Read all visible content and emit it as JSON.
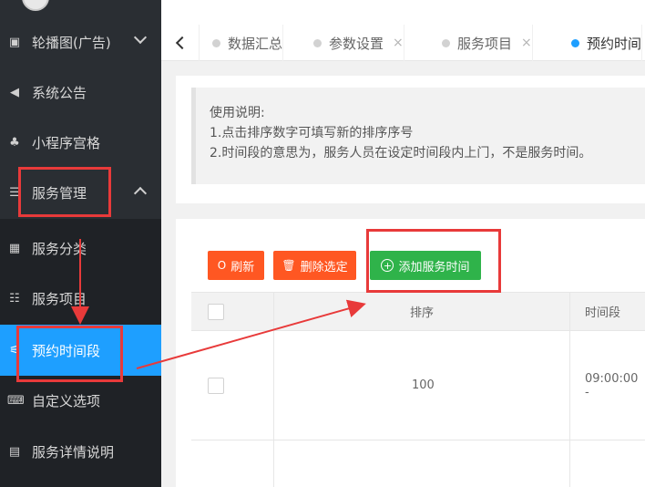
{
  "sidebar": {
    "user": {
      "name": ""
    },
    "items": [
      {
        "label": "轮播图(广告)",
        "icon": "image-icon",
        "glyph": "▣",
        "expand": "down"
      },
      {
        "label": "系统公告",
        "icon": "speaker-icon",
        "glyph": "◀",
        "expand": ""
      },
      {
        "label": "小程序宫格",
        "icon": "sitemap-icon",
        "glyph": "♣",
        "expand": ""
      },
      {
        "label": "服务管理",
        "icon": "list-icon",
        "glyph": "☰",
        "expand": "up"
      }
    ],
    "subitems": [
      {
        "label": "服务分类",
        "icon": "grid-icon",
        "glyph": "▦",
        "active": false
      },
      {
        "label": "服务项目",
        "icon": "list-icon",
        "glyph": "☷",
        "active": false
      },
      {
        "label": "预约时间段",
        "icon": "sliders-icon",
        "glyph": "⚟",
        "active": true
      },
      {
        "label": "自定义选项",
        "icon": "keyboard-icon",
        "glyph": "⌨",
        "active": false
      },
      {
        "label": "服务详情说明",
        "icon": "file-icon",
        "glyph": "▤",
        "active": false
      }
    ]
  },
  "tabs": [
    {
      "label": "数据汇总",
      "closable": false,
      "active": false
    },
    {
      "label": "参数设置",
      "closable": true,
      "active": false
    },
    {
      "label": "服务项目",
      "closable": true,
      "active": false
    },
    {
      "label": "预约时间",
      "closable": false,
      "active": true
    }
  ],
  "tab_close_glyph": "×",
  "note": {
    "title": "使用说明:",
    "line1": "1.点击排序数字可填写新的排序序号",
    "line2": "2.时间段的意思为，服务人员在设定时间段内上门，不是服务时间。"
  },
  "toolbar": {
    "refresh_label": "刷新",
    "refresh_glyph": "O",
    "delete_label": "删除选定",
    "delete_glyph": "🗑",
    "add_label": "添加服务时间",
    "add_glyph": "+"
  },
  "table": {
    "headers": {
      "sort": "排序",
      "period": "时间段"
    },
    "rows": [
      {
        "sort": "100",
        "period": "09:00:00 -"
      }
    ]
  },
  "colors": {
    "sidebar_bg": "#2a2e33",
    "active_blue": "#1e9fff",
    "danger_orange": "#ff5722",
    "success_green": "#2fb34a",
    "annotation_red": "#e83a3a"
  }
}
